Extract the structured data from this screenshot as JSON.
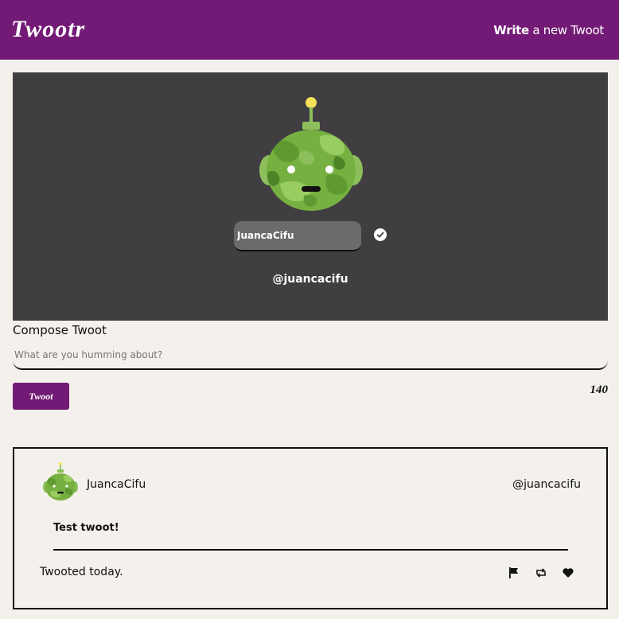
{
  "header": {
    "logo": "Twootr",
    "write_link_bold": "Write",
    "write_link_rest": " a new Twoot"
  },
  "profile": {
    "display_name_value": "JuancaCifu",
    "handle": "@juancacifu",
    "avatar_icon": "robot-avatar-icon",
    "confirm_icon": "check-circle-icon"
  },
  "compose": {
    "title": "Compose Twoot",
    "placeholder": "What are you humming about?",
    "button_label": "Twoot",
    "char_counter": "140"
  },
  "tweets": [
    {
      "name": "JuancaCifu",
      "handle": "@juancacifu",
      "text": "Test twoot!",
      "time": "Twooted today.",
      "actions": [
        "flag-icon",
        "retweet-icon",
        "heart-icon"
      ]
    }
  ],
  "colors": {
    "brand": "#721a75",
    "background": "#f4f1ec",
    "profile_panel": "#413e41",
    "avatar_green": "#76b041"
  }
}
